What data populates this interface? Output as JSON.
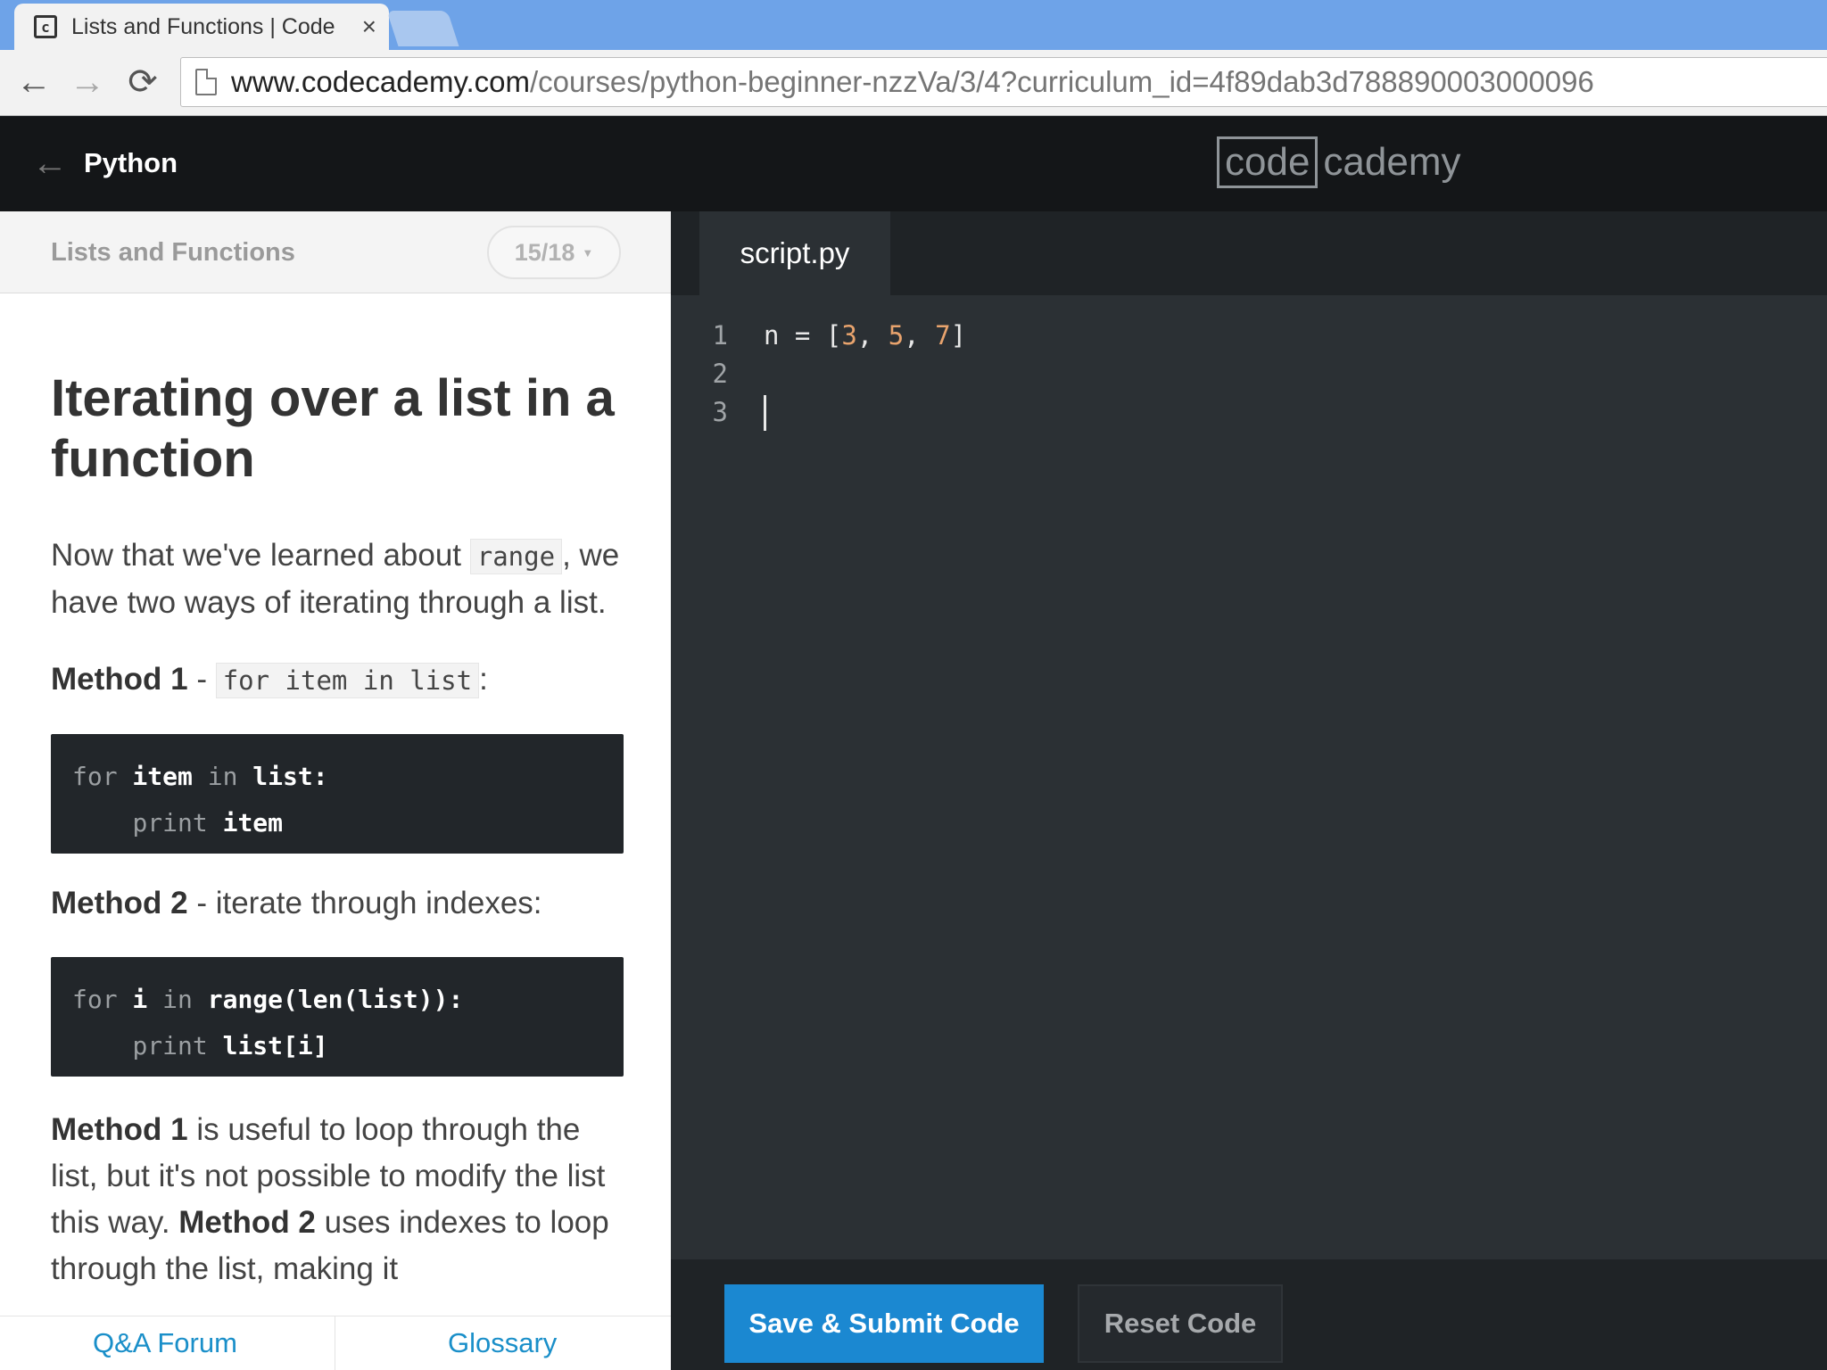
{
  "browser": {
    "tab_title": "Lists and Functions | Code",
    "tab_close": "×",
    "favicon_glyph": "c",
    "url_host": "www.codecademy.com",
    "url_path": "/courses/python-beginner-nzzVa/3/4?curriculum_id=4f89dab3d788890003000096",
    "back_icon": "←",
    "forward_icon": "→",
    "reload_icon": "⟳"
  },
  "header": {
    "back_icon": "←",
    "course_title": "Python",
    "logo_code": "code",
    "logo_cademy": "cademy"
  },
  "lesson": {
    "name": "Lists and Functions",
    "progress": "15/18",
    "caret": "▼"
  },
  "content": {
    "title": "Iterating over a list in a function",
    "intro_before": "Now that we've learned about ",
    "intro_code": "range",
    "intro_after": ", we have two ways of iterating through a list.",
    "method1_label": "Method 1",
    "method1_sep": " - ",
    "method1_code": "for item in list",
    "method1_after": ":",
    "code1": {
      "line1_kw": "for",
      "line1_a": " item ",
      "line1_kw2": "in",
      "line1_b": " list:",
      "line2_indent": "    ",
      "line2_kw": "print",
      "line2_a": " item"
    },
    "method2_label": "Method 2",
    "method2_text": " - iterate through indexes:",
    "code2": {
      "line1_kw": "for",
      "line1_a": " i ",
      "line1_kw2": "in",
      "line1_b": " range(len(list)):",
      "line2_indent": "    ",
      "line2_kw": "print",
      "line2_a": " list[i]"
    },
    "summary_m1": "Method 1",
    "summary_a": " is useful to loop through the list, but it's not possible to modify the list this way. ",
    "summary_m2": "Method 2",
    "summary_b": " uses indexes to loop through the list, making it"
  },
  "footer": {
    "qa_forum": "Q&A Forum",
    "glossary": "Glossary"
  },
  "editor": {
    "file_tab": "script.py",
    "lines": [
      {
        "number": "1"
      },
      {
        "number": "2"
      },
      {
        "number": "3"
      }
    ],
    "line1": {
      "a": "n = [",
      "n1": "3",
      "c1": ", ",
      "n2": "5",
      "c2": ", ",
      "n3": "7",
      "b": "]"
    },
    "submit_label": "Save & Submit Code",
    "reset_label": "Reset Code"
  }
}
